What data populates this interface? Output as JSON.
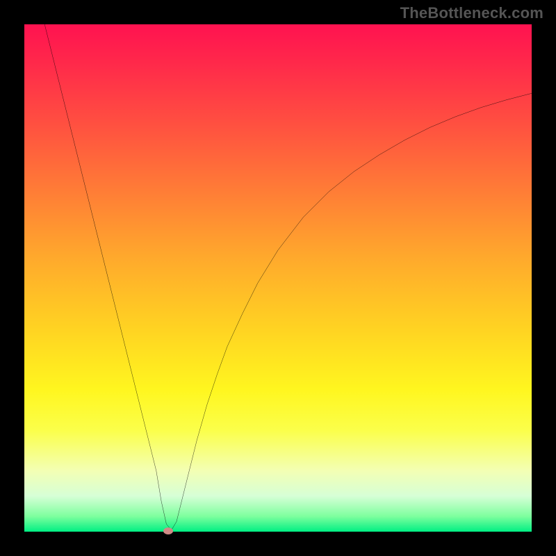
{
  "watermark": "TheBottleneck.com",
  "chart_data": {
    "type": "line",
    "title": "",
    "xlabel": "",
    "ylabel": "",
    "xlim": [
      0,
      100
    ],
    "ylim": [
      0,
      100
    ],
    "grid": false,
    "legend": false,
    "series": [
      {
        "name": "bottleneck-curve",
        "x": [
          4,
          6,
          8,
          10,
          12,
          14,
          16,
          18,
          20,
          22,
          24,
          26,
          27,
          28,
          29,
          30,
          32,
          34,
          36,
          38,
          40,
          43,
          46,
          50,
          55,
          60,
          65,
          70,
          75,
          80,
          85,
          90,
          95,
          100
        ],
        "values": [
          100,
          92,
          84,
          76,
          68,
          60,
          52,
          44,
          36,
          28,
          20,
          12,
          6,
          1.5,
          0.3,
          2,
          10,
          18,
          25,
          31,
          36.5,
          43,
          49,
          55.5,
          62,
          67,
          71,
          74.3,
          77.2,
          79.7,
          81.8,
          83.6,
          85.1,
          86.4
        ]
      }
    ],
    "marker": {
      "x": 28.4,
      "y": 0.2
    },
    "background_gradient": {
      "top": "#ff1250",
      "bottom": "#00ef83",
      "meaning": "red=high bottleneck, green=optimal"
    }
  }
}
